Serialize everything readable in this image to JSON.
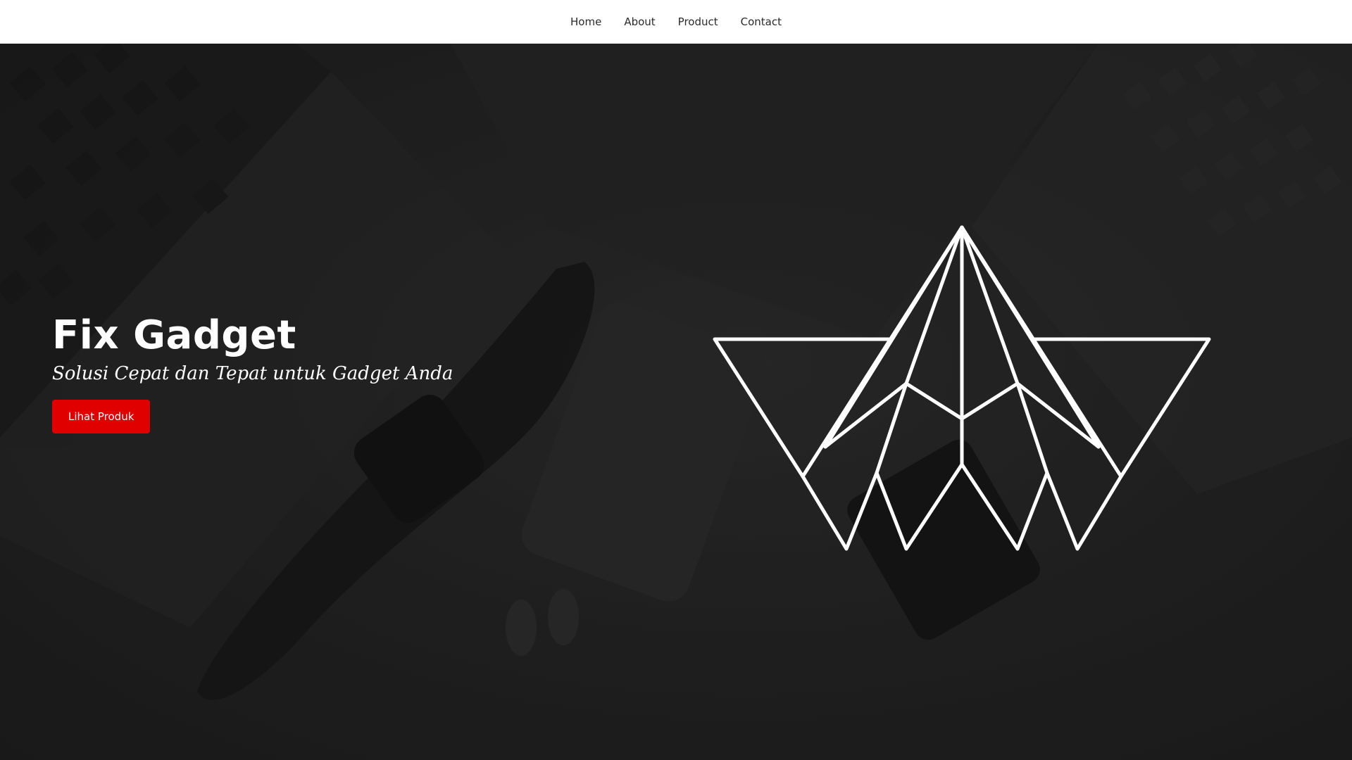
{
  "nav": {
    "items": [
      {
        "label": "Home"
      },
      {
        "label": "About"
      },
      {
        "label": "Product"
      },
      {
        "label": "Contact"
      }
    ]
  },
  "hero": {
    "title": "Fix Gadget",
    "subtitle": "Solusi Cepat dan Tepat untuk Gadget Anda",
    "cta_label": "Lihat Produk",
    "background_image": "dark desk photo with laptop keyboard, smartwatch, iPhone, iPad and AirPods",
    "logo": "geometric-origami-crown-logo"
  },
  "colors": {
    "accent": "#e00000",
    "navbar_bg": "#ffffff",
    "hero_overlay": "#1c1c1c",
    "text": "#ffffff"
  }
}
